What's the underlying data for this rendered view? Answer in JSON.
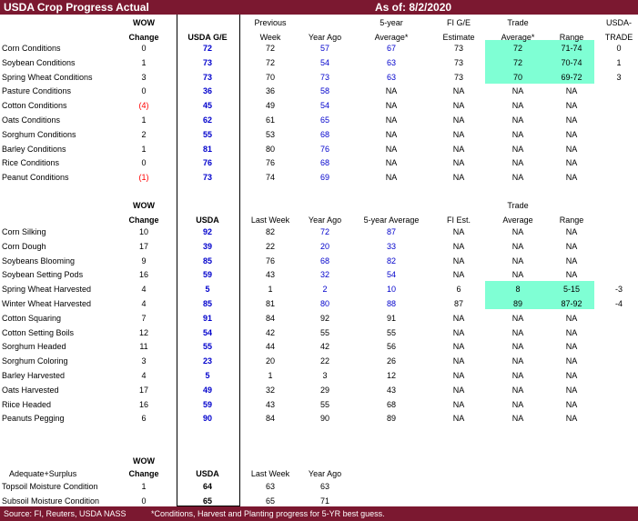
{
  "title": "USDA Crop Progress Actual",
  "as_of": "As of:  8/2/2020",
  "footer_source": "Source: FI, Reuters, USDA NASS",
  "footer_note": "*Conditions, Harvest and Planting progress for 5-YR best guess.",
  "colors": {
    "banner": "#7b1830",
    "highlight": "#7fffd4",
    "blue_value": "#0000cc",
    "red_value": "#ff0000"
  },
  "sections": [
    {
      "id": "conditions",
      "header_lines": [
        [
          "",
          "WOW",
          "",
          "Previous",
          "",
          "5-year",
          "FI G/E",
          "Trade",
          "",
          "USDA-"
        ],
        [
          "",
          "Change",
          "USDA G/E",
          "Week",
          "Year Ago",
          "Average*",
          "Estimate",
          "Average*",
          "Range",
          "TRADE"
        ]
      ],
      "rows": [
        {
          "label": "Corn Conditions",
          "cells": [
            "0",
            "72",
            "72",
            "57",
            "67",
            "73",
            "72",
            "71-74",
            "0"
          ]
        },
        {
          "label": "Soybean Conditions",
          "cells": [
            "1",
            "73",
            "72",
            "54",
            "63",
            "73",
            "72",
            "70-74",
            "1"
          ]
        },
        {
          "label": "Spring Wheat Conditions",
          "cells": [
            "3",
            "73",
            "70",
            "73",
            "63",
            "73",
            "70",
            "69-72",
            "3"
          ]
        },
        {
          "label": "Pasture Conditions",
          "cells": [
            "0",
            "36",
            "36",
            "58",
            "NA",
            "NA",
            "NA",
            "NA",
            ""
          ]
        },
        {
          "label": "Cotton Conditions",
          "cells": [
            "(4)",
            "45",
            "49",
            "54",
            "NA",
            "NA",
            "NA",
            "NA",
            ""
          ]
        },
        {
          "label": "Oats Conditions",
          "cells": [
            "1",
            "62",
            "61",
            "65",
            "NA",
            "NA",
            "NA",
            "NA",
            ""
          ]
        },
        {
          "label": "Sorghum Conditions",
          "cells": [
            "2",
            "55",
            "53",
            "68",
            "NA",
            "NA",
            "NA",
            "NA",
            ""
          ]
        },
        {
          "label": "Barley Conditions",
          "cells": [
            "1",
            "81",
            "80",
            "76",
            "NA",
            "NA",
            "NA",
            "NA",
            ""
          ]
        },
        {
          "label": "Rice Conditions",
          "cells": [
            "0",
            "76",
            "76",
            "68",
            "NA",
            "NA",
            "NA",
            "NA",
            ""
          ]
        },
        {
          "label": "Peanut Conditions",
          "cells": [
            "(1)",
            "73",
            "74",
            "69",
            "NA",
            "NA",
            "NA",
            "NA",
            ""
          ]
        }
      ]
    },
    {
      "id": "progress",
      "header_lines": [
        [
          "",
          "",
          "",
          "",
          "",
          "",
          "",
          "Trade",
          "",
          ""
        ],
        [
          "",
          "WOW",
          "",
          "",
          "",
          "",
          "",
          "",
          "",
          ""
        ],
        [
          "",
          "Change",
          "USDA",
          "Last Week",
          "Year Ago",
          "5-year Average",
          "FI Est.",
          "Average",
          "Range",
          ""
        ]
      ],
      "rows": [
        {
          "label": "Corn Silking",
          "cells": [
            "10",
            "92",
            "82",
            "72",
            "87",
            "NA",
            "NA",
            "NA",
            ""
          ]
        },
        {
          "label": "Corn Dough",
          "cells": [
            "17",
            "39",
            "22",
            "20",
            "33",
            "NA",
            "NA",
            "NA",
            ""
          ]
        },
        {
          "label": "Soybeans Blooming",
          "cells": [
            "9",
            "85",
            "76",
            "68",
            "82",
            "NA",
            "NA",
            "NA",
            ""
          ]
        },
        {
          "label": "Soybean Setting Pods",
          "cells": [
            "16",
            "59",
            "43",
            "32",
            "54",
            "NA",
            "NA",
            "NA",
            ""
          ]
        },
        {
          "label": "Spring Wheat Harvested",
          "cells": [
            "4",
            "5",
            "1",
            "2",
            "10",
            "6",
            "8",
            "5-15",
            "-3"
          ]
        },
        {
          "label": "Winter Wheat Harvested",
          "cells": [
            "4",
            "85",
            "81",
            "80",
            "88",
            "87",
            "89",
            "87-92",
            "-4"
          ]
        },
        {
          "label": "Cotton Squaring",
          "cells": [
            "7",
            "91",
            "84",
            "92",
            "91",
            "NA",
            "NA",
            "NA",
            ""
          ]
        },
        {
          "label": "Cotton Setting Boils",
          "cells": [
            "12",
            "54",
            "42",
            "55",
            "55",
            "NA",
            "NA",
            "NA",
            ""
          ]
        },
        {
          "label": "Sorghum Headed",
          "cells": [
            "11",
            "55",
            "44",
            "42",
            "56",
            "NA",
            "NA",
            "NA",
            ""
          ]
        },
        {
          "label": "Sorghum Coloring",
          "cells": [
            "3",
            "23",
            "20",
            "22",
            "26",
            "NA",
            "NA",
            "NA",
            ""
          ]
        },
        {
          "label": "Barley Harvested",
          "cells": [
            "4",
            "5",
            "1",
            "3",
            "12",
            "NA",
            "NA",
            "NA",
            ""
          ]
        },
        {
          "label": "Oats Harvested",
          "cells": [
            "17",
            "49",
            "32",
            "29",
            "43",
            "NA",
            "NA",
            "NA",
            ""
          ]
        },
        {
          "label": "Riice Headed",
          "cells": [
            "16",
            "59",
            "43",
            "55",
            "68",
            "NA",
            "NA",
            "NA",
            ""
          ]
        },
        {
          "label": "Peanuts Pegging",
          "cells": [
            "6",
            "90",
            "84",
            "90",
            "89",
            "NA",
            "NA",
            "NA",
            ""
          ]
        }
      ]
    },
    {
      "id": "moisture",
      "header_lines": [
        [
          "",
          "WOW",
          "",
          "",
          "",
          "",
          "",
          "",
          "",
          ""
        ],
        [
          "Adequate+Surplus",
          "Change",
          "USDA",
          "Last Week",
          "Year Ago",
          "",
          "",
          "",
          "",
          ""
        ]
      ],
      "rows": [
        {
          "label": "Topsoil Moisture Condition",
          "cells": [
            "1",
            "64",
            "63",
            "63",
            "",
            "",
            "",
            "",
            ""
          ]
        },
        {
          "label": "Subsoil Moisture Condition",
          "cells": [
            "0",
            "65",
            "65",
            "71",
            "",
            "",
            "",
            "",
            ""
          ]
        }
      ]
    }
  ]
}
